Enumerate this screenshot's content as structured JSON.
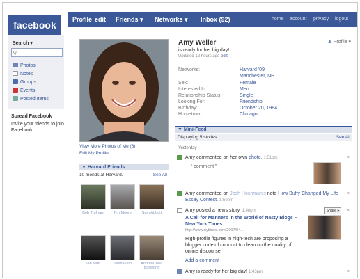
{
  "app": {
    "logo": "facebook"
  },
  "nav": {
    "profile": "Profile",
    "edit": "edit",
    "friends": "Friends ▾",
    "networks": "Networks ▾",
    "inbox": "Inbox (92)",
    "right": [
      "home",
      "account",
      "privacy",
      "logout"
    ]
  },
  "sidebar": {
    "search_label": "Search ▾",
    "search_placeholder": "Q",
    "items": [
      "Photos",
      "Notes",
      "Groups",
      "Events",
      "Posted Items"
    ],
    "spread_title": "Spread Facebook",
    "spread_text": "Invite your friends to join Facebook."
  },
  "left": {
    "view_more_photos": "View More Photos of Me (6)",
    "edit_profile": "Edit My Profile",
    "friends_header": "▼ Harvard Friends",
    "friends_count": "10 friends at Harvard.",
    "see_all": "See All",
    "friend_names": [
      "Bob Trafham",
      "Tim Moore",
      "Sam Abbott",
      "Ian Mott",
      "Sasha Lim",
      "Andrew 'Bell' Bosworth"
    ]
  },
  "profile": {
    "name": "Amy Weller",
    "status": "is ready for her big day!",
    "updated": "Updated 12 hours ago",
    "updated_edit": "edit",
    "profile_button": "Profile ▾",
    "info": [
      {
        "label": "Networks:",
        "value": "Harvard '09"
      },
      {
        "label": "",
        "value": "Manchester, NH"
      },
      {
        "label": "Sex:",
        "value": "Female"
      },
      {
        "label": "Interested In:",
        "value": "Men"
      },
      {
        "label": "Relationship Status:",
        "value": "Single"
      },
      {
        "label": "Looking For:",
        "value": "Friendship"
      },
      {
        "label": "Birthday:",
        "value": "October 20, 1984"
      },
      {
        "label": "Hometown:",
        "value": "Chicago"
      }
    ]
  },
  "feed": {
    "header": "▼ Mini-Feed",
    "displaying": "Displaying 5 stories.",
    "see_all": "See All",
    "day": "Yesterday",
    "item1_a": "Amy commented on her own",
    "item1_link": "photo.",
    "item1_time": "1:51pm",
    "item1_comment": "“ comment ”",
    "item2_a": "Amy commented on",
    "item2_b": "Josh Hochman's",
    "item2_c": "note",
    "item2_link": "How Buffy Changed My Life Essay Contest.",
    "item2_time": "1:50pm",
    "item3_a": "Amy posted a news story.",
    "item3_time": "1:48pm",
    "item3_share": "Share ▸",
    "story_title": "A Call for Manners in the World of Nasty Blogs – New York Times",
    "story_url": "http://www.nytimes.com/2007/04...",
    "story_body": "High-profile figures in high-tech are proposing a blogger code of conduct to clean up the quality of online discourse.",
    "add_comment": "Add a comment",
    "item4_a": "Amy is ready for her big day!",
    "item4_time": "1:43pm",
    "close": "×"
  },
  "colors": {
    "brand": "#3b5998",
    "light_blue": "#d8dfea",
    "pale": "#edeff4"
  }
}
